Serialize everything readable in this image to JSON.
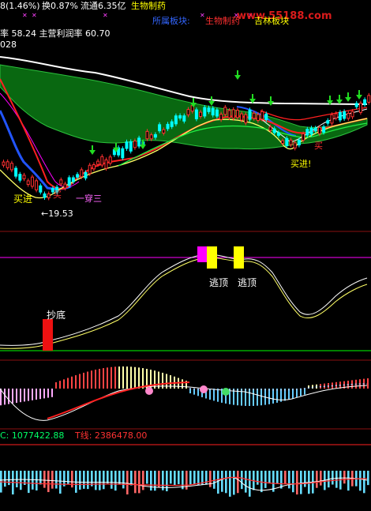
{
  "header": {
    "line1": {
      "price_change": "8(1.46%)",
      "turnover": "换0.87%",
      "float_cap": "流通6.35亿",
      "sector": "生物制药"
    },
    "overlay": {
      "sector_label": "所属板块:",
      "sector_value": "生物制药",
      "block_label": "吉林板块",
      "watermark": "www.55188.com"
    },
    "line2": {
      "margin_text": "率 58.24 主营利润率 60.70",
      "code_fragment": "028"
    }
  },
  "panel1": {
    "annotations": {
      "low_price": "←19.53",
      "buy_in_left": "买进",
      "buy_left": "买",
      "pattern": "一穿三",
      "buy_in_right": "买进!",
      "buy_right": "买"
    }
  },
  "panel2": {
    "annotations": {
      "bottom": "抄底",
      "top1": "逃顶",
      "top2": "逃顶"
    }
  },
  "panel4": {
    "c_label": "C: 1077422.88",
    "t_label": "T线: 2386478.00"
  },
  "colors": {
    "background": "#000000",
    "up_candle": "#ff3030",
    "down_candle": "#00ffff",
    "band_fill": "#0a6e12",
    "white_line": "#ffffff",
    "magenta_line": "#ff00ff",
    "yellow_line": "#ffff66",
    "green_arrow": "#22dd22",
    "buy_text": "#ffff00",
    "sell_text": "#ff3030",
    "c_label": "#00ff66",
    "t_label": "#ff3333",
    "sector_label": "#3366ff",
    "block_label": "#ffff00",
    "watermark": "#ff2020"
  },
  "chart_data": [
    {
      "type": "candlestick",
      "panel": "price",
      "title": "",
      "low_marker": 19.53,
      "legend": []
    },
    {
      "type": "line",
      "panel": "oscillator",
      "annotations": [
        "抄底",
        "逃顶",
        "逃顶"
      ]
    },
    {
      "type": "bar",
      "panel": "macd_style_histogram"
    },
    {
      "type": "bar",
      "panel": "volume_style",
      "series": [
        {
          "name": "C",
          "values": [
            1077422.88
          ]
        },
        {
          "name": "T线",
          "values": [
            2386478.0
          ]
        }
      ]
    }
  ]
}
